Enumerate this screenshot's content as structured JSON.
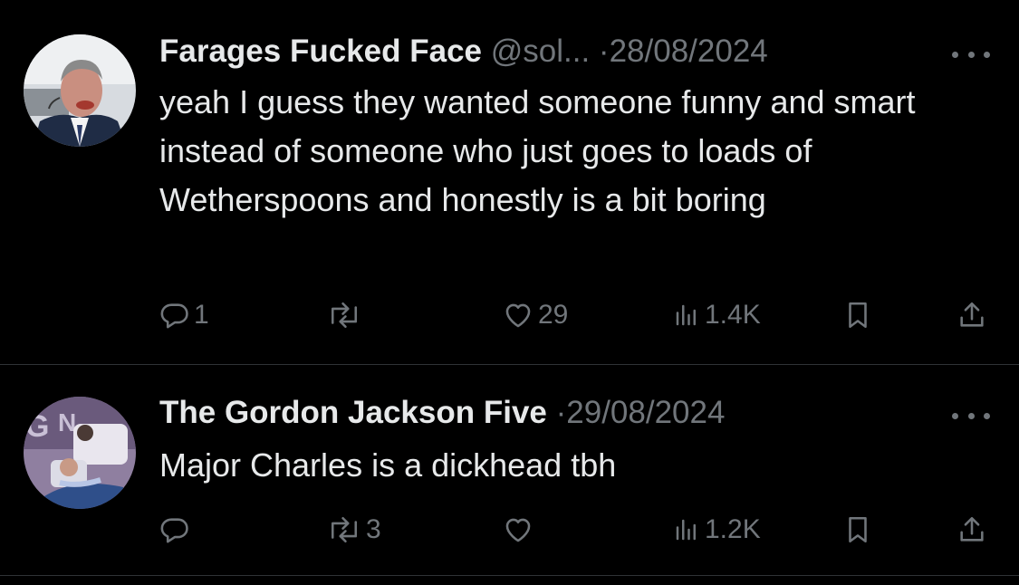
{
  "tweets": [
    {
      "name": "Farages Fucked Face",
      "handle": "@sol...",
      "separator": "·",
      "date": "28/08/2024",
      "text": "yeah I guess they wanted someone funny and smart instead of someone who just goes to loads of Wetherspoons and honestly is a bit boring",
      "actions": {
        "replies": "1",
        "reposts": "",
        "likes": "29",
        "views": "1.4K"
      }
    },
    {
      "name": "The Gordon Jackson Five",
      "handle": "",
      "separator": "·",
      "date": "29/08/2024",
      "text": "Major Charles is a dickhead tbh",
      "actions": {
        "replies": "",
        "reposts": "3",
        "likes": "",
        "views": "1.2K"
      }
    }
  ],
  "icons": {
    "reply": "reply-icon",
    "repost": "repost-icon",
    "like": "heart-icon",
    "views": "views-icon",
    "bookmark": "bookmark-icon",
    "share": "share-icon",
    "more": "more-icon"
  },
  "colors": {
    "background": "#000000",
    "text": "#e7e9ea",
    "secondary": "#71767b",
    "divider": "#2f3336"
  }
}
